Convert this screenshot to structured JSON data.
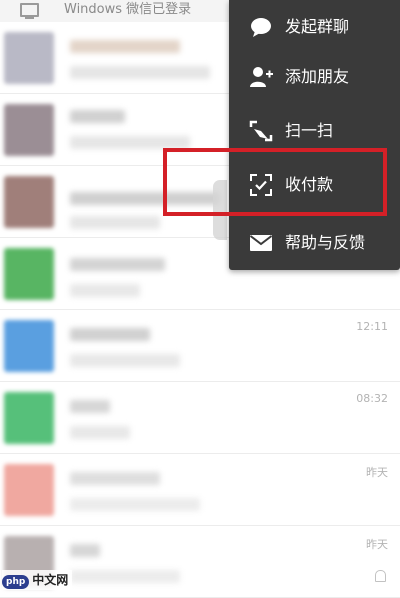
{
  "banner": {
    "text": "Windows 微信已登录"
  },
  "chats": [
    {
      "time": "",
      "avatar_color": "#b9b9c6",
      "line1_color": "#d6d0d2",
      "line2_color": "#e5e5e5"
    },
    {
      "time": "",
      "avatar_color": "#9b8e95",
      "line1_color": "#d0d0d0",
      "line2_color": "#e6e6e6"
    },
    {
      "time": "",
      "avatar_color": "#a07f7a",
      "line1_color": "#cfcfcf",
      "line2_color": "#e6e6e6"
    },
    {
      "time": "",
      "avatar_color": "#58b563",
      "line1_color": "#d3d3d3",
      "line2_color": "#e8e8e8"
    },
    {
      "time": "12:11",
      "avatar_color": "#5a9fe0",
      "line1_color": "#d0d0d0",
      "line2_color": "#e8e8e8"
    },
    {
      "time": "08:32",
      "avatar_color": "#56c07a",
      "line1_color": "#d6d6d6",
      "line2_color": "#e8e8e8"
    },
    {
      "time": "昨天",
      "avatar_color": "#f0a8a0",
      "line1_color": "#dedede",
      "line2_color": "#ececec"
    },
    {
      "time": "昨天",
      "avatar_color": "#b8b0b0",
      "line1_color": "#d6d6d6",
      "line2_color": "#ececec",
      "muted": true
    }
  ],
  "menu": {
    "background": "#3a3a3a",
    "items": [
      {
        "label": "发起群聊",
        "icon": "chat-bubble-icon"
      },
      {
        "label": "添加朋友",
        "icon": "add-friend-icon"
      },
      {
        "label": "扫一扫",
        "icon": "scan-icon"
      },
      {
        "label": "收付款",
        "icon": "payment-icon"
      },
      {
        "label": "帮助与反馈",
        "icon": "mail-icon"
      }
    ]
  },
  "highlight_color": "#d42027",
  "watermark": {
    "badge": "php",
    "text": "中文网"
  }
}
